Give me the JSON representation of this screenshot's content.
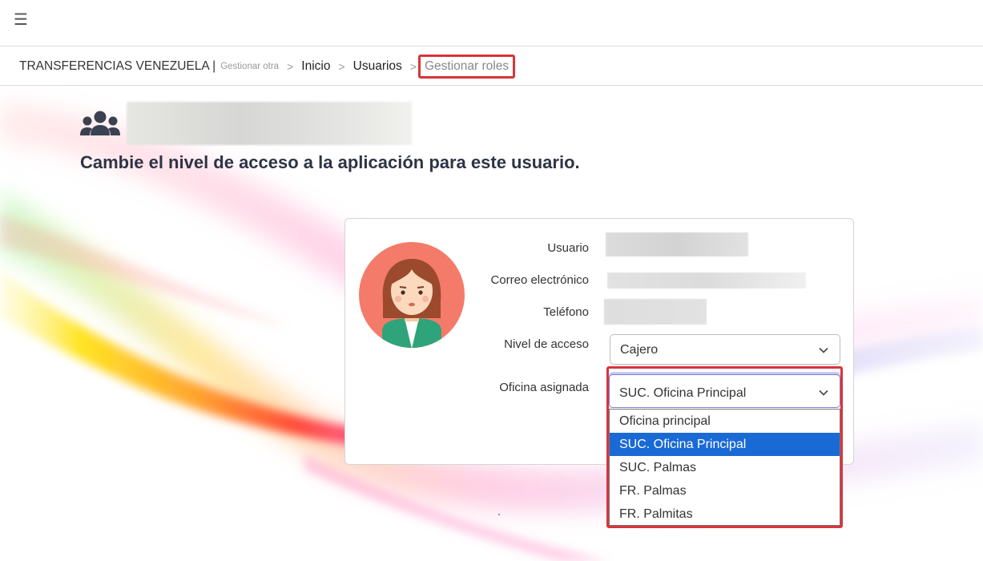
{
  "topbar": {
    "menu_icon": "hamburger-menu-icon"
  },
  "breadcrumb": {
    "company": "TRANSFERENCIAS VENEZUELA |",
    "manage_other": "Gestionar otra",
    "separator": ">",
    "items": [
      "Inicio",
      "Usuarios"
    ],
    "current": "Gestionar roles"
  },
  "header": {
    "icon": "users-group-icon",
    "subtitle": "Cambie el nivel de acceso a la aplicación para este usuario."
  },
  "form": {
    "user_label": "Usuario",
    "email_label": "Correo electrónico",
    "phone_label": "Teléfono",
    "access_label": "Nivel de acceso",
    "access_value": "Cajero",
    "office_label": "Oficina asignada",
    "office_value": "SUC. Oficina Principal",
    "office_options": [
      "Oficina principal",
      "SUC. Oficina Principal",
      "SUC. Palmas",
      "FR. Palmas",
      "FR. Palmitas"
    ],
    "selected_option_index": 1
  },
  "colors": {
    "highlight_border": "#d9343b",
    "selected_option_bg": "#1a6ad6",
    "title_text": "#2e3446",
    "avatar_bg": "#f47b69"
  }
}
